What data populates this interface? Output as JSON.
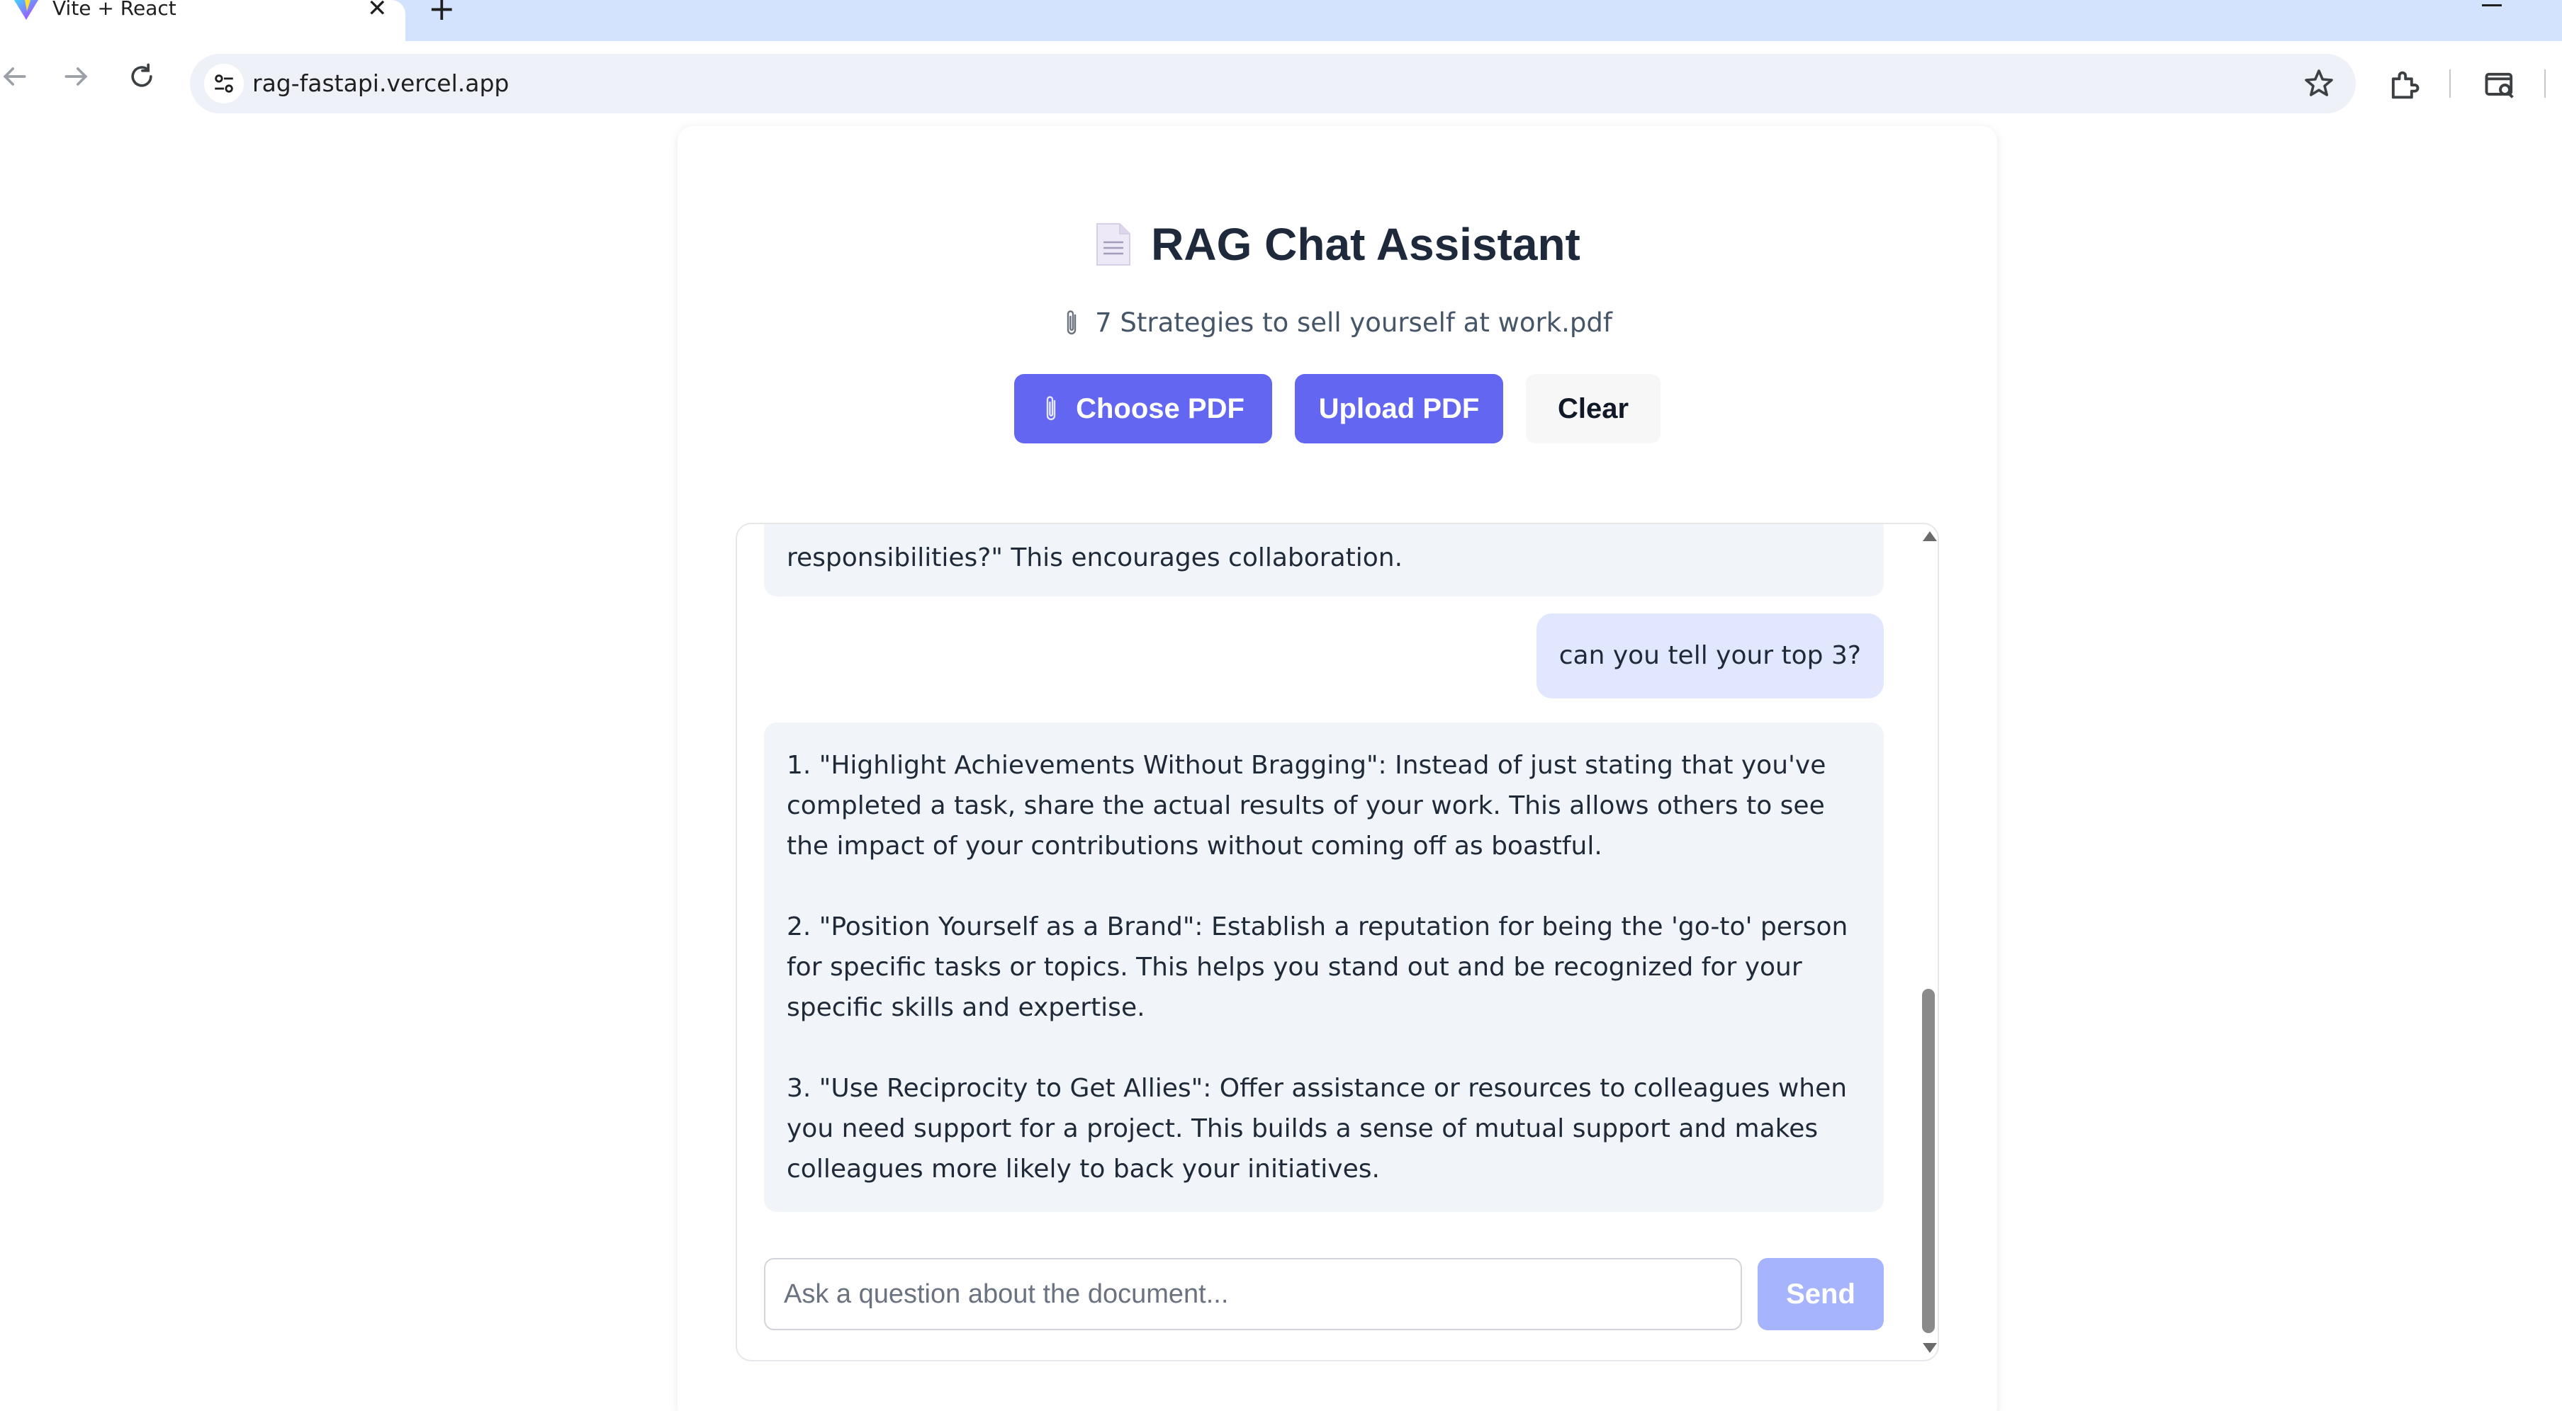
{
  "browser": {
    "tab_title": "Vite + React",
    "tab_close": "✕",
    "new_tab": "+",
    "url": "rag-fastapi.vercel.app"
  },
  "app": {
    "title": "RAG Chat Assistant",
    "file_name": "7 Strategies to sell yourself at work.pdf",
    "buttons": {
      "choose": "Choose PDF",
      "upload": "Upload PDF",
      "clear": "Clear"
    },
    "accent_color": "#6366f1"
  },
  "chat": {
    "messages": [
      {
        "role": "assistant",
        "text": "responsibilities?\" This encourages collaboration."
      },
      {
        "role": "user",
        "text": "can you tell your top 3?"
      },
      {
        "role": "assistant",
        "paragraphs": [
          "1. \"Highlight Achievements Without Bragging\": Instead of just stating that you've completed a task, share the actual results of your work. This allows others to see the impact of your contributions without coming off as boastful.",
          "2. \"Position Yourself as a Brand\": Establish a reputation for being the 'go-to' person for specific tasks or topics. This helps you stand out and be recognized for your specific skills and expertise.",
          "3. \"Use Reciprocity to Get Allies\": Offer assistance or resources to colleagues when you need support for a project. This builds a sense of mutual support and makes colleagues more likely to back your initiatives."
        ]
      }
    ],
    "input_placeholder": "Ask a question about the document...",
    "input_value": "",
    "send_label": "Send"
  }
}
